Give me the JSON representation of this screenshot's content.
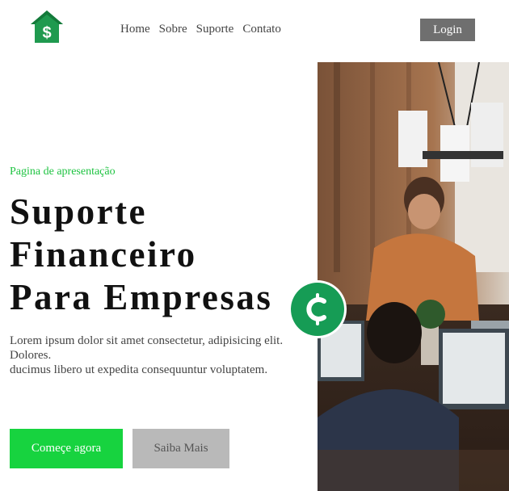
{
  "header": {
    "logo_icon": "house-dollar-icon",
    "nav": [
      "Home",
      "Sobre",
      "Suporte",
      "Contato"
    ],
    "login_label": "Login"
  },
  "hero": {
    "eyebrow": "Pagina de apresentação",
    "headline": [
      "Suporte",
      "Financeiro",
      "Para Empresas"
    ],
    "description_line1": "Lorem ipsum dolor sit amet consectetur, adipisicing elit. Dolores.",
    "description_line2": "ducimus libero ut expedita consequuntur voluptatem.",
    "primary_button": "Começe agora",
    "secondary_button": "Saiba Mais"
  },
  "badge": {
    "icon": "currency-coin-icon",
    "color": "#169c55"
  },
  "colors": {
    "accent": "#17d33f",
    "logo": "#1f9a4f",
    "login_bg": "#6f6f6f",
    "secondary_bg": "#b9b9b9"
  }
}
